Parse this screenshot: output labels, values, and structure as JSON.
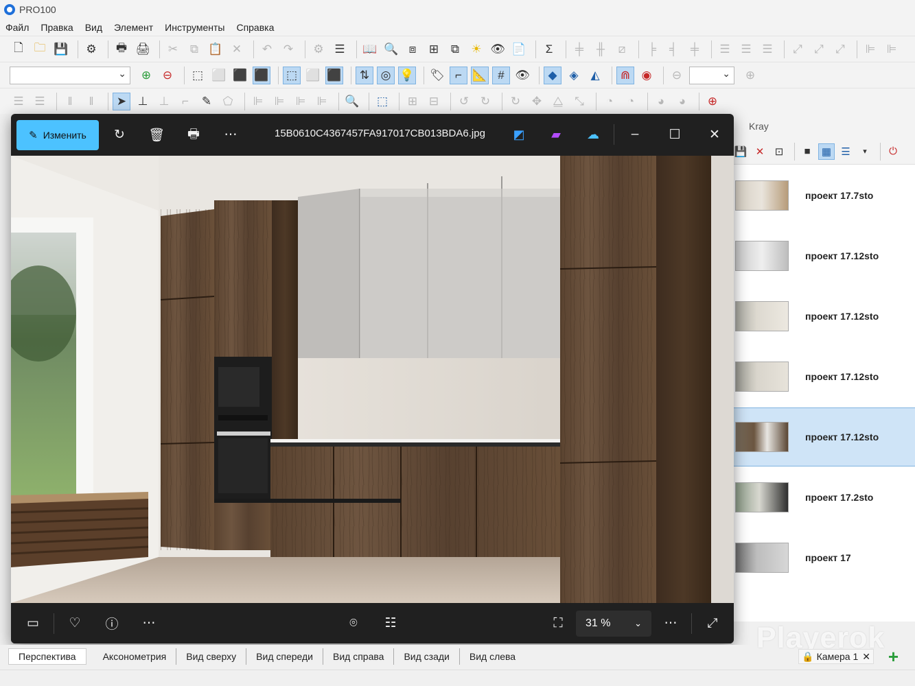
{
  "app": {
    "title": "PRO100"
  },
  "menu": [
    "Файл",
    "Правка",
    "Вид",
    "Элемент",
    "Инструменты",
    "Справка"
  ],
  "viewer": {
    "edit_label": "Изменить",
    "filename": "15B0610C4367457FA917017CB013BDA6.jpg",
    "zoom": "31 %"
  },
  "panel": {
    "title": "Kray",
    "projects": [
      {
        "name": "проект 17.7sto"
      },
      {
        "name": "проект 17.12sto"
      },
      {
        "name": "проект 17.12sto"
      },
      {
        "name": "проект 17.12sto"
      },
      {
        "name": "проект 17.12sto",
        "selected": true
      },
      {
        "name": "проект 17.2sto"
      },
      {
        "name": "проект 17"
      }
    ]
  },
  "view_tabs": [
    "Перспектива",
    "Аксонометрия",
    "Вид сверху",
    "Вид спереди",
    "Вид справа",
    "Вид сзади",
    "Вид слева"
  ],
  "camera": {
    "label": "Камера 1"
  },
  "watermark": "Playerok",
  "colors": {
    "accent": "#4cc2ff",
    "selection": "#cfe4f7",
    "viewer_bg": "#202020"
  }
}
